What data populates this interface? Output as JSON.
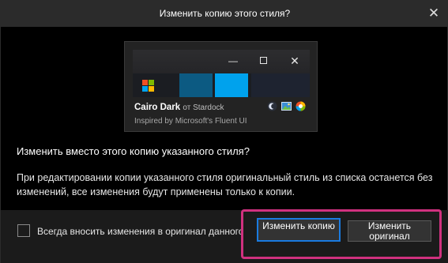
{
  "dialog": {
    "title": "Изменить копию этого стиля?",
    "close_glyph": "✕"
  },
  "preview": {
    "min_glyph": "—",
    "close_glyph": "✕",
    "style_name": "Cairo Dark",
    "by_text": "от Stardock",
    "description": "Inspired by Microsoft's Fluent UI",
    "icons": [
      "moon-icon",
      "image-icon",
      "color-wheel-icon"
    ],
    "swatch_colors": [
      "#0c5a82",
      "#00a2ed",
      "#1e2330"
    ]
  },
  "question": "Изменить вместо этого копию указанного стиля?",
  "explanation": "При редактировании копии указанного стиля оригинальный стиль из списка останется без изменений, все изменения будут применены только к копии.",
  "footer": {
    "checkbox_label": "Всегда вносить изменения в оригинал данного",
    "checkbox_checked": false,
    "button_copy": "Изменить копию",
    "button_original": "Изменить оригинал"
  },
  "colors": {
    "accent": "#1a7be0",
    "highlight": "#d0317f"
  }
}
